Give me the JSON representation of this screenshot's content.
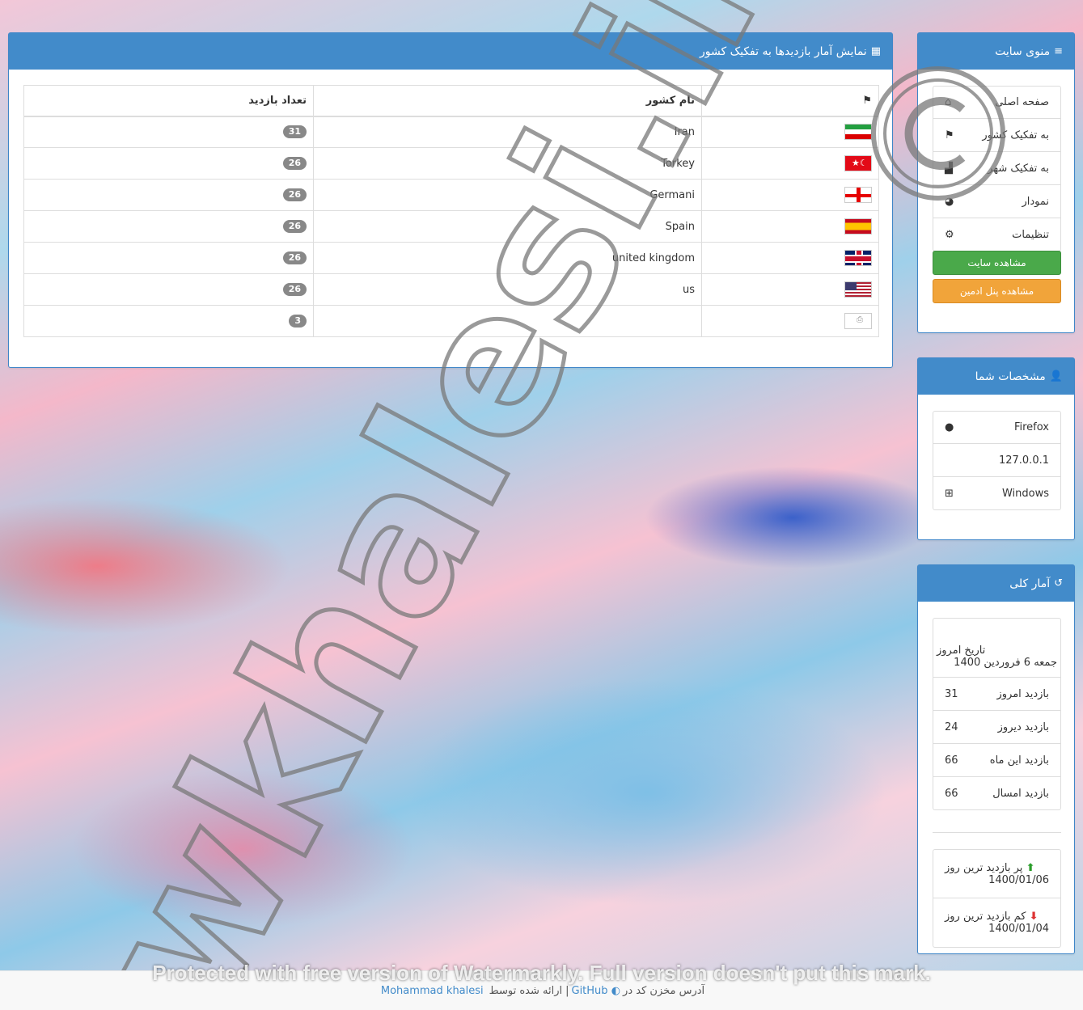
{
  "main": {
    "title": "نمایش آمار بازدیدها به تفکیک کشور",
    "title_icon": "table-icon",
    "columns": {
      "flag": "flag-header-icon",
      "country": "نام کشور",
      "visits": "تعداد بازدید"
    },
    "rows": [
      {
        "flag": "ir",
        "country": "Iran",
        "visits": "31"
      },
      {
        "flag": "tr",
        "country": "Torkey",
        "visits": "26"
      },
      {
        "flag": "ge",
        "country": "Germani",
        "visits": "26"
      },
      {
        "flag": "es",
        "country": "Spain",
        "visits": "26"
      },
      {
        "flag": "gb",
        "country": "united kingdom",
        "visits": "26"
      },
      {
        "flag": "us",
        "country": "us",
        "visits": "26"
      },
      {
        "flag": "unknown",
        "country": "",
        "visits": "3"
      }
    ]
  },
  "menu": {
    "title": "منوی سایت",
    "items": [
      {
        "label": "صفحه اصلی",
        "icon": "home-icon"
      },
      {
        "label": "به تفکیک کشور",
        "icon": "flag-icon"
      },
      {
        "label": "به تفکیک شهر",
        "icon": "bar-chart-icon"
      },
      {
        "label": "نمودار",
        "icon": "pie-chart-icon"
      },
      {
        "label": "تنظیمات",
        "icon": "gears-icon"
      }
    ],
    "view_site": "مشاهده سایت",
    "view_admin": "مشاهده پنل ادمین"
  },
  "info": {
    "title": "مشخصات شما",
    "items": [
      {
        "label": "Firefox",
        "icon": "globe-icon"
      },
      {
        "label": "127.0.0.1",
        "icon": ""
      },
      {
        "label": "Windows",
        "icon": "windows-icon"
      }
    ]
  },
  "stats": {
    "title": "آمار کلی",
    "date_label": "تاریخ امروز",
    "date_value": "جمعه 6 فروردین 1400",
    "items": [
      {
        "label": "بازدید امروز",
        "value": "31"
      },
      {
        "label": "بازدید دیروز",
        "value": "24"
      },
      {
        "label": "بازدید این ماه",
        "value": "66"
      },
      {
        "label": "بازدید امسال",
        "value": "66"
      }
    ],
    "most_label": "پر بازدید ترین روز",
    "most_date": "1400/01/06",
    "least_label": "کم بازدید ترین روز",
    "least_date": "1400/01/04"
  },
  "footer": {
    "text1": "آدرس مخزن کد در",
    "github": "GitHub",
    "sep": "|",
    "text2": "ارائه شده توسط",
    "author": "Mohammad khalesi"
  },
  "watermark": {
    "banner": "Protected with free version of Watermarkly. Full version doesn't put this mark.",
    "logo": "wkhalesi.ir"
  },
  "colors": {
    "primary": "#428bca",
    "success": "#4aa94a",
    "warning": "#f1a43a",
    "badge": "#888888"
  }
}
